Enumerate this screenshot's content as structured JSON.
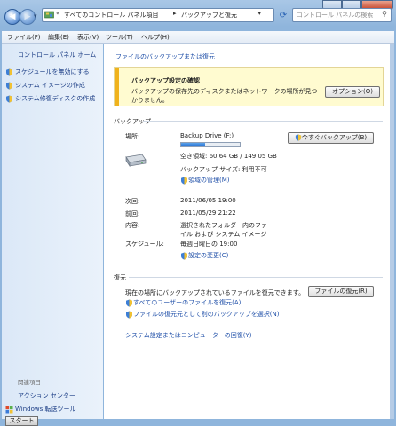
{
  "addressbar": {
    "chevron": "«",
    "segments": [
      "すべてのコントロール パネル項目",
      "バックアップと復元"
    ],
    "search_placeholder": "コントロール パネルの検索"
  },
  "menubar": [
    "ファイル(F)",
    "編集(E)",
    "表示(V)",
    "ツール(T)",
    "ヘルプ(H)"
  ],
  "sidebar": {
    "home": "コントロール パネル ホーム",
    "tasks": [
      "スケジュールを無効にする",
      "システム イメージの作成",
      "システム修復ディスクの作成"
    ],
    "related_heading": "関連項目",
    "action_center": "アクション センター",
    "transfer": "Windows 転送ツール"
  },
  "main": {
    "title": "ファイルのバックアップまたは復元",
    "notice": {
      "title": "バックアップ設定の確認",
      "body": "バックアップの保存先のディスクまたはネットワークの場所が見つかりません。",
      "button": "オプション(O)"
    },
    "backup": {
      "heading": "バックアップ",
      "location_label": "場所:",
      "drive_name": "Backup Drive (F:)",
      "used_fraction": 0.41,
      "free_space": "空き領域: 60.64 GB / 149.05 GB",
      "backup_size": "バックアップ サイズ: 利用不可",
      "manage_space": "領域の管理(M)",
      "backup_now": "今すぐバックアップ(B)",
      "next_label": "次回:",
      "next_value": "2011/06/05 19:00",
      "last_label": "前回:",
      "last_value": "2011/05/29 21:22",
      "contents_label": "内容:",
      "contents_value": "選択されたフォルダー内のファイル および システム イメージ",
      "schedule_label": "スケジュール:",
      "schedule_value": "毎週日曜日の 19:00",
      "change_settings": "設定の変更(C)"
    },
    "restore": {
      "heading": "復元",
      "description": "現在の場所にバックアップされているファイルを復元できます。",
      "restore_button": "ファイルの復元(R)",
      "restore_all_users": "すべてのユーザーのファイルを復元(A)",
      "select_other": "ファイルの復元元として別のバックアップを選択(N)",
      "recover_system": "システム設定またはコンピューターの回復(Y)"
    }
  },
  "taskbar": {
    "start": "スタート"
  },
  "colors": {
    "link": "#1f4fa8",
    "notice_accent": "#f0b21b",
    "notice_bg": "#fffbd0"
  }
}
